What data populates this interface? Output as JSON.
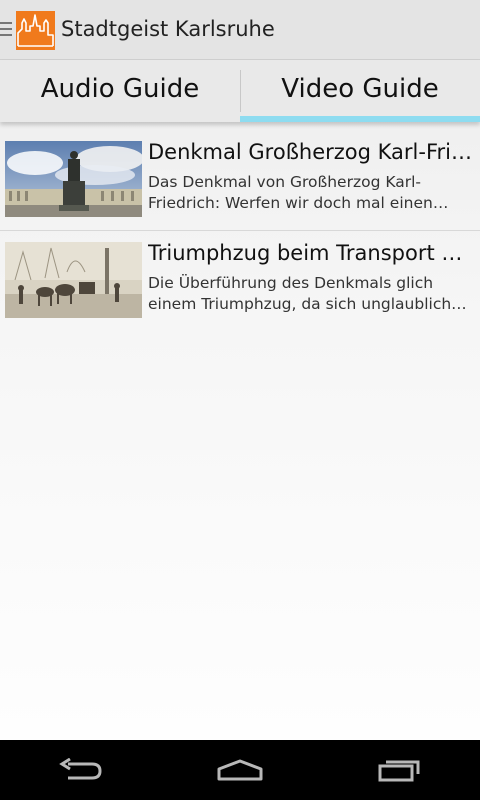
{
  "app": {
    "title": "Stadtgeist Karlsruhe",
    "accent_color": "#f07a1c"
  },
  "tabs": [
    {
      "label": "Audio Guide",
      "selected": false
    },
    {
      "label": "Video Guide",
      "selected": true
    }
  ],
  "tab_indicator_color": "#8edcf0",
  "videos": [
    {
      "title": "Denkmal Großherzog Karl-Friedrich",
      "description": "Das Denkmal von Großherzog Karl-Friedrich: Werfen wir doch mal einen Blick auf das Denkmal",
      "thumbnail": "monument-statue-palace-photo"
    },
    {
      "title": "Triumphzug beim Transport des Denkmals",
      "description": "Die Überführung des Denkmals glich einem Triumphzug, da sich unglaublich viele Menschen versammelten",
      "thumbnail": "historic-horse-cart-photo"
    }
  ],
  "nav": {
    "back": "back-icon",
    "home": "home-icon",
    "recents": "recent-apps-icon"
  }
}
